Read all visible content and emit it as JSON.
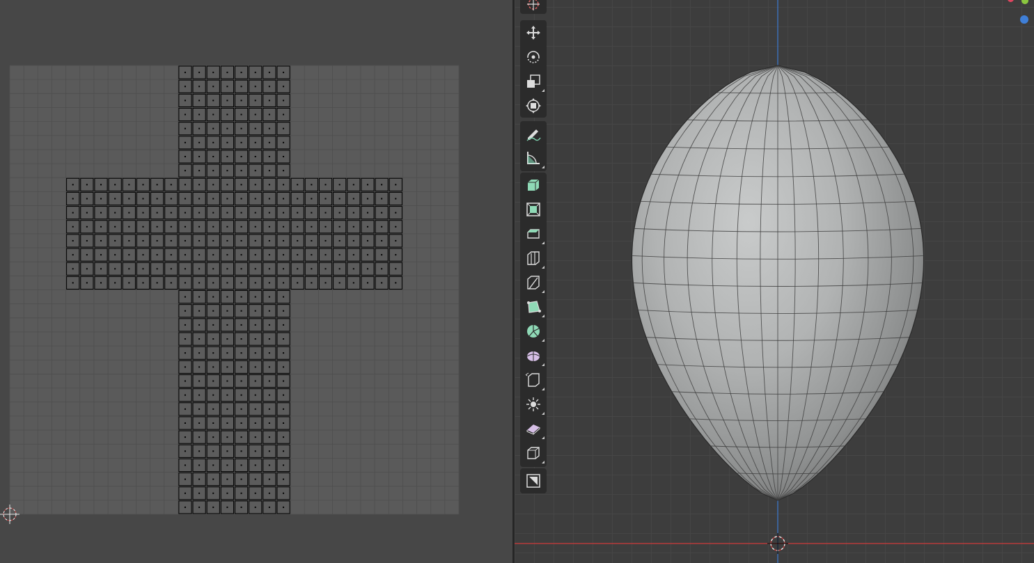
{
  "uv_editor": {
    "colors": {
      "background": "#474747",
      "canvas": "#5a5a5a",
      "grid": "#505050",
      "face_fill": "#5c5c5c",
      "edge": "#000000",
      "cursor": "#c94343"
    }
  },
  "viewport": {
    "colors": {
      "background": "#3d3d3d",
      "axis_x": "#b53b3b",
      "axis_z": "#3d6fb5",
      "mesh_light": "#c9cbcb",
      "mesh_dark": "#6e6e6e"
    },
    "axis_gizmo": [
      {
        "name": "x-axis-dot",
        "color": "#e0455f"
      },
      {
        "name": "y-axis-dot",
        "color": "#8bc63f"
      },
      {
        "name": "z-axis-dot",
        "color": "#3f7fd8"
      }
    ]
  },
  "toolbar": {
    "tools": [
      {
        "name": "cursor-tool",
        "icon": "cursor-icon"
      },
      {
        "name": "move-tool",
        "icon": "move-icon"
      },
      {
        "name": "rotate-tool",
        "icon": "rotate-icon"
      },
      {
        "name": "scale-tool",
        "icon": "scale-icon"
      },
      {
        "name": "transform-tool",
        "icon": "transform-icon"
      },
      {
        "name": "annotate-tool",
        "icon": "annotate-icon"
      },
      {
        "name": "measure-tool",
        "icon": "measure-icon"
      },
      {
        "name": "extrude-region-tool",
        "icon": "extrude-region-icon"
      },
      {
        "name": "inset-faces-tool",
        "icon": "inset-faces-icon"
      },
      {
        "name": "bevel-tool",
        "icon": "bevel-icon"
      },
      {
        "name": "loop-cut-tool",
        "icon": "loop-cut-icon"
      },
      {
        "name": "knife-tool",
        "icon": "knife-icon"
      },
      {
        "name": "poly-build-tool",
        "icon": "poly-build-icon"
      },
      {
        "name": "spin-tool",
        "icon": "spin-icon"
      },
      {
        "name": "smooth-tool",
        "icon": "smooth-icon"
      },
      {
        "name": "edge-slide-tool",
        "icon": "edge-slide-icon"
      },
      {
        "name": "shrink-fatten-tool",
        "icon": "shrink-fatten-icon"
      },
      {
        "name": "shear-tool",
        "icon": "shear-icon"
      },
      {
        "name": "rip-region-tool",
        "icon": "rip-region-icon"
      },
      {
        "name": "add-cube-tool",
        "icon": "add-cube-icon"
      }
    ]
  }
}
